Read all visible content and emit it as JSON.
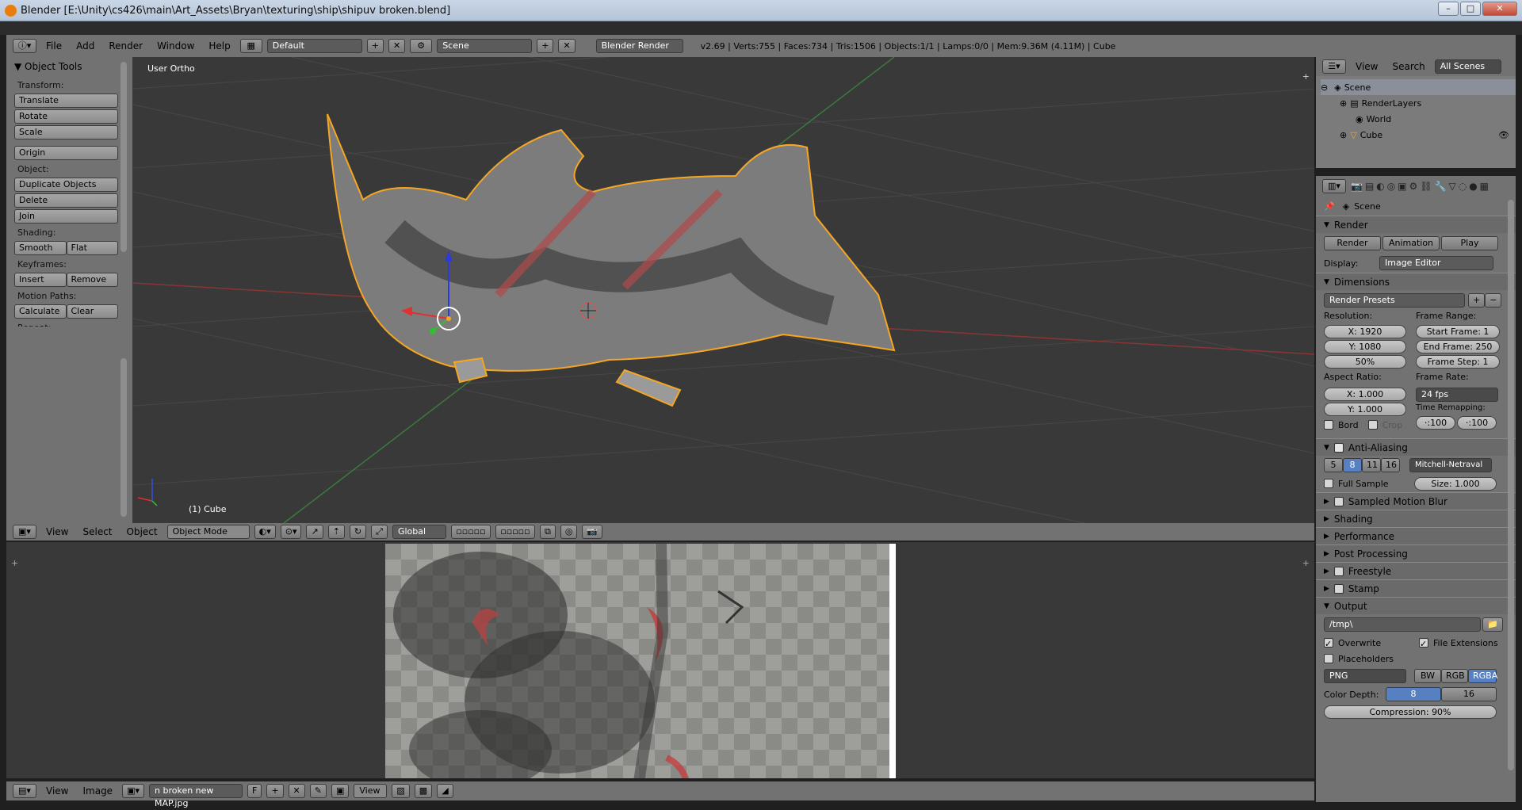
{
  "window": {
    "title": "Blender [E:\\Unity\\cs426\\main\\Art_Assets\\Bryan\\texturing\\ship\\shipuv broken.blend]",
    "min": "–",
    "max": "□",
    "close": "✕"
  },
  "info_header": {
    "menus": [
      "File",
      "Add",
      "Render",
      "Window",
      "Help"
    ],
    "layout": "Default",
    "scene": "Scene",
    "engine": "Blender Render",
    "stats": "v2.69 | Verts:755 | Faces:734 | Tris:1506 | Objects:1/1 | Lamps:0/0 | Mem:9.36M (4.11M) | Cube"
  },
  "viewport": {
    "label": "User Ortho",
    "object_label": "(1) Cube"
  },
  "tool_shelf": {
    "title": "Object Tools",
    "transform_label": "Transform:",
    "translate": "Translate",
    "rotate": "Rotate",
    "scale": "Scale",
    "origin": "Origin",
    "object_label": "Object:",
    "duplicate": "Duplicate Objects",
    "delete": "Delete",
    "join": "Join",
    "shading_label": "Shading:",
    "smooth": "Smooth",
    "flat": "Flat",
    "keyframes_label": "Keyframes:",
    "insert": "Insert",
    "remove": "Remove",
    "motion_label": "Motion Paths:",
    "calculate": "Calculate",
    "clear": "Clear",
    "repeat_label": "Repeat:"
  },
  "view3d_header": {
    "menus": [
      "View",
      "Select",
      "Object"
    ],
    "mode": "Object Mode",
    "orientation": "Global"
  },
  "uv_header": {
    "menus": [
      "View",
      "Image"
    ],
    "image": "n broken new MAP.jpg",
    "fake_user": "F",
    "view_menu": "View"
  },
  "outliner": {
    "menus": [
      "View",
      "Search"
    ],
    "display": "All Scenes",
    "items": [
      {
        "label": "Scene"
      },
      {
        "label": "RenderLayers"
      },
      {
        "label": "World"
      },
      {
        "label": "Cube"
      }
    ]
  },
  "properties": {
    "context": "Scene",
    "render_panel": "Render",
    "render_btn": "Render",
    "animation_btn": "Animation",
    "play_btn": "Play",
    "display_label": "Display:",
    "display_value": "Image Editor",
    "dimensions_panel": "Dimensions",
    "render_presets": "Render Presets",
    "resolution_label": "Resolution:",
    "res_x": "X: 1920",
    "res_y": "Y: 1080",
    "res_pct": "50%",
    "frame_range_label": "Frame Range:",
    "start_frame": "Start Frame: 1",
    "end_frame": "End Frame: 250",
    "frame_step": "Frame Step: 1",
    "aspect_label": "Aspect Ratio:",
    "aspect_x": "X: 1.000",
    "aspect_y": "Y: 1.000",
    "frame_rate_label": "Frame Rate:",
    "frame_rate": "24 fps",
    "border": "Bord",
    "crop": "Crop",
    "time_remap_label": "Time Remapping:",
    "remap_old": "·:100",
    "remap_new": "·:100",
    "aa_panel": "Anti-Aliasing",
    "aa_samples": [
      "5",
      "8",
      "11",
      "16"
    ],
    "aa_selected": "8",
    "aa_filter": "Mitchell-Netraval",
    "full_sample": "Full Sample",
    "aa_size": "Size: 1.000",
    "collapsed_panels": [
      "Sampled Motion Blur",
      "Shading",
      "Performance",
      "Post Processing",
      "Freestyle",
      "Stamp"
    ],
    "output_panel": "Output",
    "output_path": "/tmp\\",
    "overwrite": "Overwrite",
    "file_ext": "File Extensions",
    "placeholders": "Placeholders",
    "format": "PNG",
    "bw": "BW",
    "rgb": "RGB",
    "rgba": "RGBA",
    "color_depth_label": "Color Depth:",
    "depth_8": "8",
    "depth_16": "16",
    "compression": "Compression: 90%"
  },
  "colors": {
    "accent": "#5680c2",
    "selection": "#f5a623",
    "viewport_bg": "#393939"
  }
}
